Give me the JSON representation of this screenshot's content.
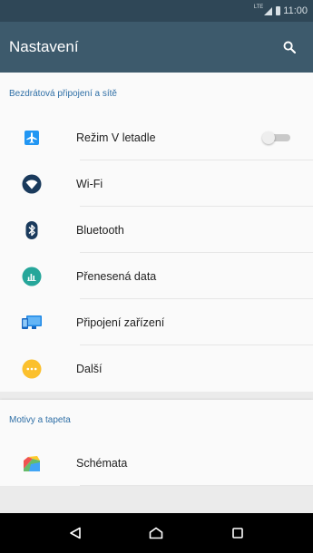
{
  "status_bar": {
    "network_type": "LTE",
    "time": "11:00"
  },
  "app_bar": {
    "title": "Nastavení",
    "search_icon": "search-icon"
  },
  "sections": [
    {
      "header": "Bezdrátová připojení a sítě",
      "items": [
        {
          "label": "Režim V letadle",
          "icon": "airplane-icon",
          "icon_color": "#2196f3",
          "toggle": true,
          "toggle_on": false
        },
        {
          "label": "Wi-Fi",
          "icon": "wifi-icon",
          "icon_color": "#1a3a5c"
        },
        {
          "label": "Bluetooth",
          "icon": "bluetooth-icon",
          "icon_color": "#1a3a5c"
        },
        {
          "label": "Přenesená data",
          "icon": "data-usage-icon",
          "icon_color": "#26a69a"
        },
        {
          "label": "Připojení zařízení",
          "icon": "device-connection-icon",
          "icon_color": "#1e88e5"
        },
        {
          "label": "Další",
          "icon": "more-icon",
          "icon_color": "#fbc02d"
        }
      ]
    },
    {
      "header": "Motivy a tapeta",
      "items": [
        {
          "label": "Schémata",
          "icon": "themes-icon"
        }
      ]
    }
  ],
  "nav_bar": {
    "back": "back-icon",
    "home": "home-icon",
    "recents": "recents-icon"
  },
  "colors": {
    "status_bar": "#2f4757",
    "app_bar": "#3d5a6c",
    "section_header": "#2f6fa6",
    "background": "#fafafa"
  }
}
